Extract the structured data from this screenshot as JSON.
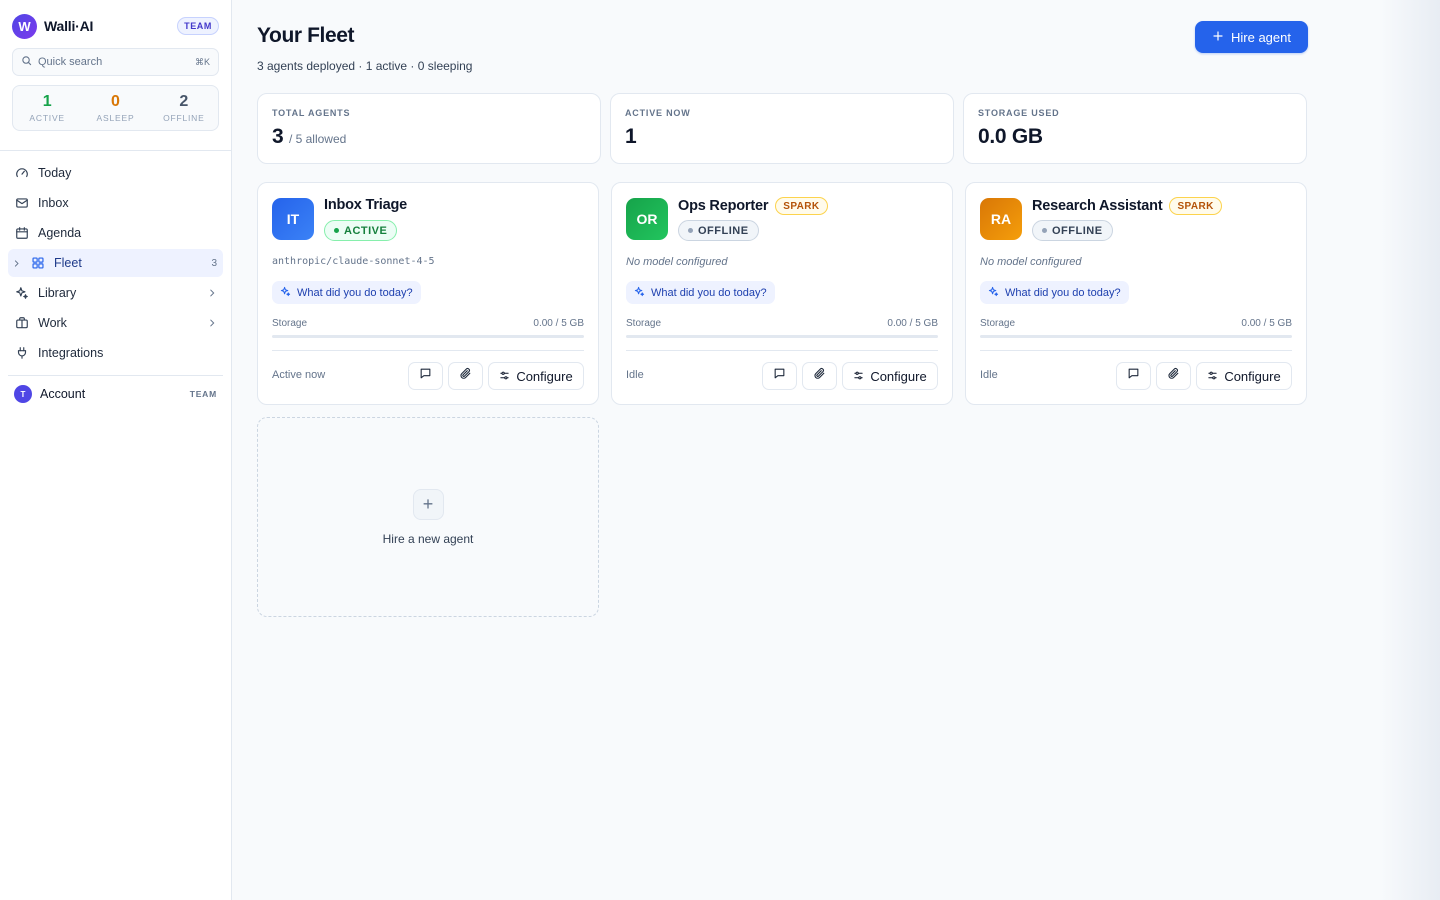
{
  "brand": {
    "initial": "W",
    "name": "Walli·AI",
    "plan": "TEAM"
  },
  "search": {
    "placeholder": "Quick search",
    "shortcut": "⌘K"
  },
  "stats": [
    {
      "value": "1",
      "label": "ACTIVE",
      "color": "#16a34a"
    },
    {
      "value": "0",
      "label": "ASLEEP",
      "color": "#d97706"
    },
    {
      "value": "2",
      "label": "OFFLINE",
      "color": "#475569"
    }
  ],
  "nav": {
    "today": "Today",
    "inbox": "Inbox",
    "agenda": "Agenda",
    "fleet": "Fleet",
    "fleet_count": "3",
    "library": "Library",
    "work": "Work",
    "integrations": "Integrations"
  },
  "account": {
    "initial": "T",
    "label": "Account",
    "tag": "TEAM"
  },
  "header": {
    "title": "Your Fleet",
    "subtitle": "3 agents deployed · 1 active · 0 sleeping",
    "hire_label": "Hire agent"
  },
  "metrics": [
    {
      "label": "TOTAL AGENTS",
      "value": "3",
      "sub": "/ 5 allowed"
    },
    {
      "label": "ACTIVE NOW",
      "value": "1",
      "sub": ""
    },
    {
      "label": "STORAGE USED",
      "value": "0.0 GB",
      "sub": ""
    }
  ],
  "agents": [
    {
      "initials": "IT",
      "name": "Inbox Triage",
      "badge": "",
      "status": "ACTIVE",
      "model": "anthropic/claude-sonnet-4-5",
      "prompt": "What did you do today?",
      "storage_label": "Storage",
      "storage_value": "0.00 / 5 GB",
      "storage_fraction": 0.0,
      "footer_status": "Active now",
      "configure_label": "Configure",
      "color": "#2563eb"
    },
    {
      "initials": "OR",
      "name": "Ops Reporter",
      "badge": "SPARK",
      "status": "OFFLINE",
      "model": "No model configured",
      "prompt": "What did you do today?",
      "storage_label": "Storage",
      "storage_value": "0.00 / 5 GB",
      "storage_fraction": 0.0,
      "footer_status": "Idle",
      "configure_label": "Configure",
      "color": "#16a34a"
    },
    {
      "initials": "RA",
      "name": "Research Assistant",
      "badge": "SPARK",
      "status": "OFFLINE",
      "model": "No model configured",
      "prompt": "What did you do today?",
      "storage_label": "Storage",
      "storage_value": "0.00 / 5 GB",
      "storage_fraction": 0.0,
      "footer_status": "Idle",
      "configure_label": "Configure",
      "color": "#d97706"
    }
  ],
  "add_card": {
    "plus": "+",
    "label": "Hire a new agent"
  },
  "icons": {
    "search": "search-icon",
    "today": "gauge-icon",
    "inbox": "mail-icon",
    "agenda": "calendar-icon",
    "fleet": "grid-icon",
    "library": "sparkles-icon",
    "work": "briefcase-icon",
    "integrations": "plug-icon",
    "chat": "message-icon",
    "attach": "paperclip-icon",
    "configure": "sliders-icon",
    "hire": "plus-icon"
  }
}
